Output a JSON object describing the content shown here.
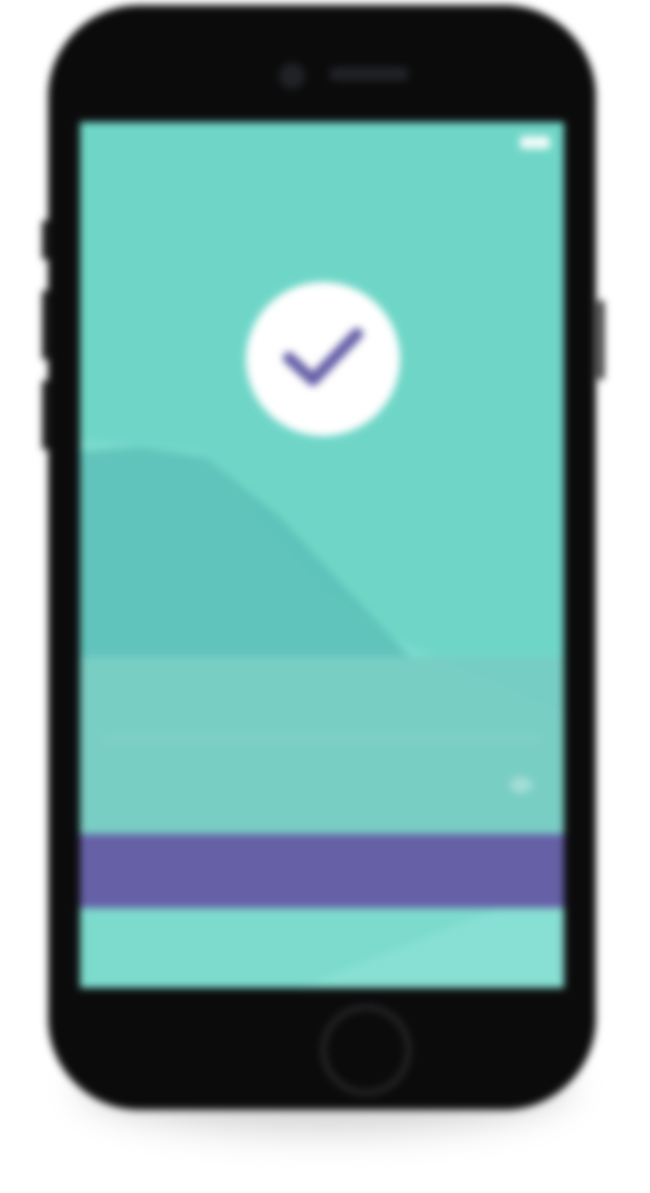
{
  "status_bar": {
    "carrier": "",
    "time": "",
    "battery_icon": "battery-icon"
  },
  "success": {
    "icon": "check-icon",
    "title": ""
  },
  "fields": [
    {
      "label": "",
      "value": ""
    },
    {
      "label": "",
      "value": ""
    }
  ],
  "primary_button": {
    "label": ""
  },
  "footer": {
    "link_text": ""
  },
  "colors": {
    "screen_background": "#6fd6c7",
    "mountain_dark": "#58bcb5",
    "mountain_light": "#82ddd1",
    "primary_button": "#6660a7",
    "check_mark": "#6660a7",
    "phone_body": "#0b0b0c"
  }
}
